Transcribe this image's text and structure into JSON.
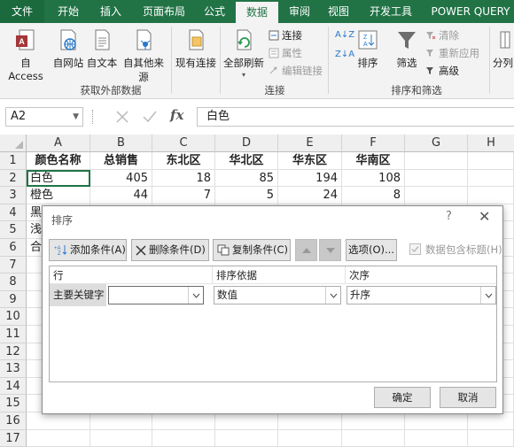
{
  "ribbon_tabs": [
    "文件",
    "开始",
    "插入",
    "页面布局",
    "公式",
    "数据",
    "审阅",
    "视图",
    "开发工具",
    "POWER QUERY"
  ],
  "active_tab": "数据",
  "ribbon": {
    "get_external": {
      "buttons": [
        "自 Access",
        "自网站",
        "自文本",
        "自其他来源",
        "现有连接"
      ],
      "group_label": "获取外部数据"
    },
    "connections": {
      "refresh_all": "全部刷新",
      "items": [
        "连接",
        "属性",
        "编辑链接"
      ],
      "group_label": "连接"
    },
    "sort_filter": {
      "az": "A↓Z",
      "za": "Z↓A",
      "sort": "排序",
      "filter": "筛选",
      "items": [
        "清除",
        "重新应用",
        "高级"
      ],
      "group_label": "排序和筛选"
    },
    "cut_off_label": "分列"
  },
  "formula_bar": {
    "name_box": "A2",
    "fx": "fx",
    "content": "白色"
  },
  "sheet": {
    "columns": [
      "A",
      "B",
      "C",
      "D",
      "E",
      "F",
      "G",
      "H"
    ],
    "rows": [
      "1",
      "2",
      "3",
      "4",
      "5",
      "6",
      "7",
      "8",
      "9",
      "10",
      "11",
      "12",
      "13",
      "14",
      "15",
      "16",
      "17"
    ],
    "header": [
      "颜色名称",
      "总销售",
      "东北区",
      "华北区",
      "华东区",
      "华南区"
    ],
    "data": [
      [
        "白色",
        "405",
        "18",
        "85",
        "194",
        "108"
      ],
      [
        "橙色",
        "44",
        "7",
        "5",
        "24",
        "8"
      ],
      [
        "黑",
        "",
        "",
        "",
        "",
        ""
      ],
      [
        "浅",
        "",
        "",
        "",
        "",
        ""
      ],
      [
        "合",
        "",
        "",
        "",
        "",
        ""
      ]
    ]
  },
  "dialog": {
    "title": "排序",
    "help": "?",
    "close": "✕",
    "add_level": "添加条件(A)",
    "delete_level": "删除条件(D)",
    "copy_level": "复制条件(C)",
    "options": "选项(O)...",
    "has_headers": "数据包含标题(H)",
    "col_headers": [
      "行",
      "排序依据",
      "次序"
    ],
    "key_label": "主要关键字",
    "key_value": "",
    "sort_on": "数值",
    "order": "升序",
    "ok": "确定",
    "cancel": "取消"
  },
  "colors": {
    "excel_green": "#217346",
    "ribbon_bg": "#f3f3f3",
    "header_bg": "#efefef"
  }
}
